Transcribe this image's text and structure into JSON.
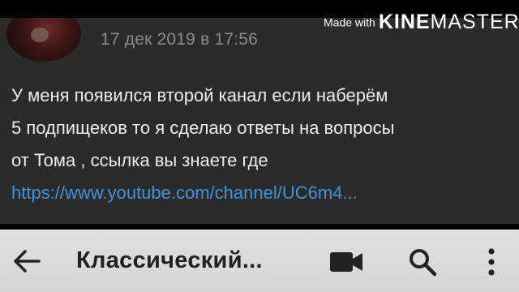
{
  "post": {
    "timestamp": "17 дек 2019 в 17:56",
    "lines": [
      "У меня появился второй канал если наберём",
      "5 подпищеков то я сделаю ответы на вопросы",
      "от Тома , ссылка вы знаете где"
    ],
    "link": "https://www.youtube.com/channel/UC6m4..."
  },
  "toolbar": {
    "title": "Классический...",
    "icons": [
      "back-arrow-icon",
      "video-camera-icon",
      "search-icon",
      "more-vert-icon"
    ]
  },
  "watermark": {
    "prefix": "Made with",
    "brand_bold": "KINE",
    "brand_light": "MASTER"
  },
  "colors": {
    "post_background": "#2b2b2b",
    "toolbar_background": "#dcdcdc",
    "link": "#3f93d8",
    "text": "#ededed",
    "timestamp": "#8a8a8a"
  }
}
